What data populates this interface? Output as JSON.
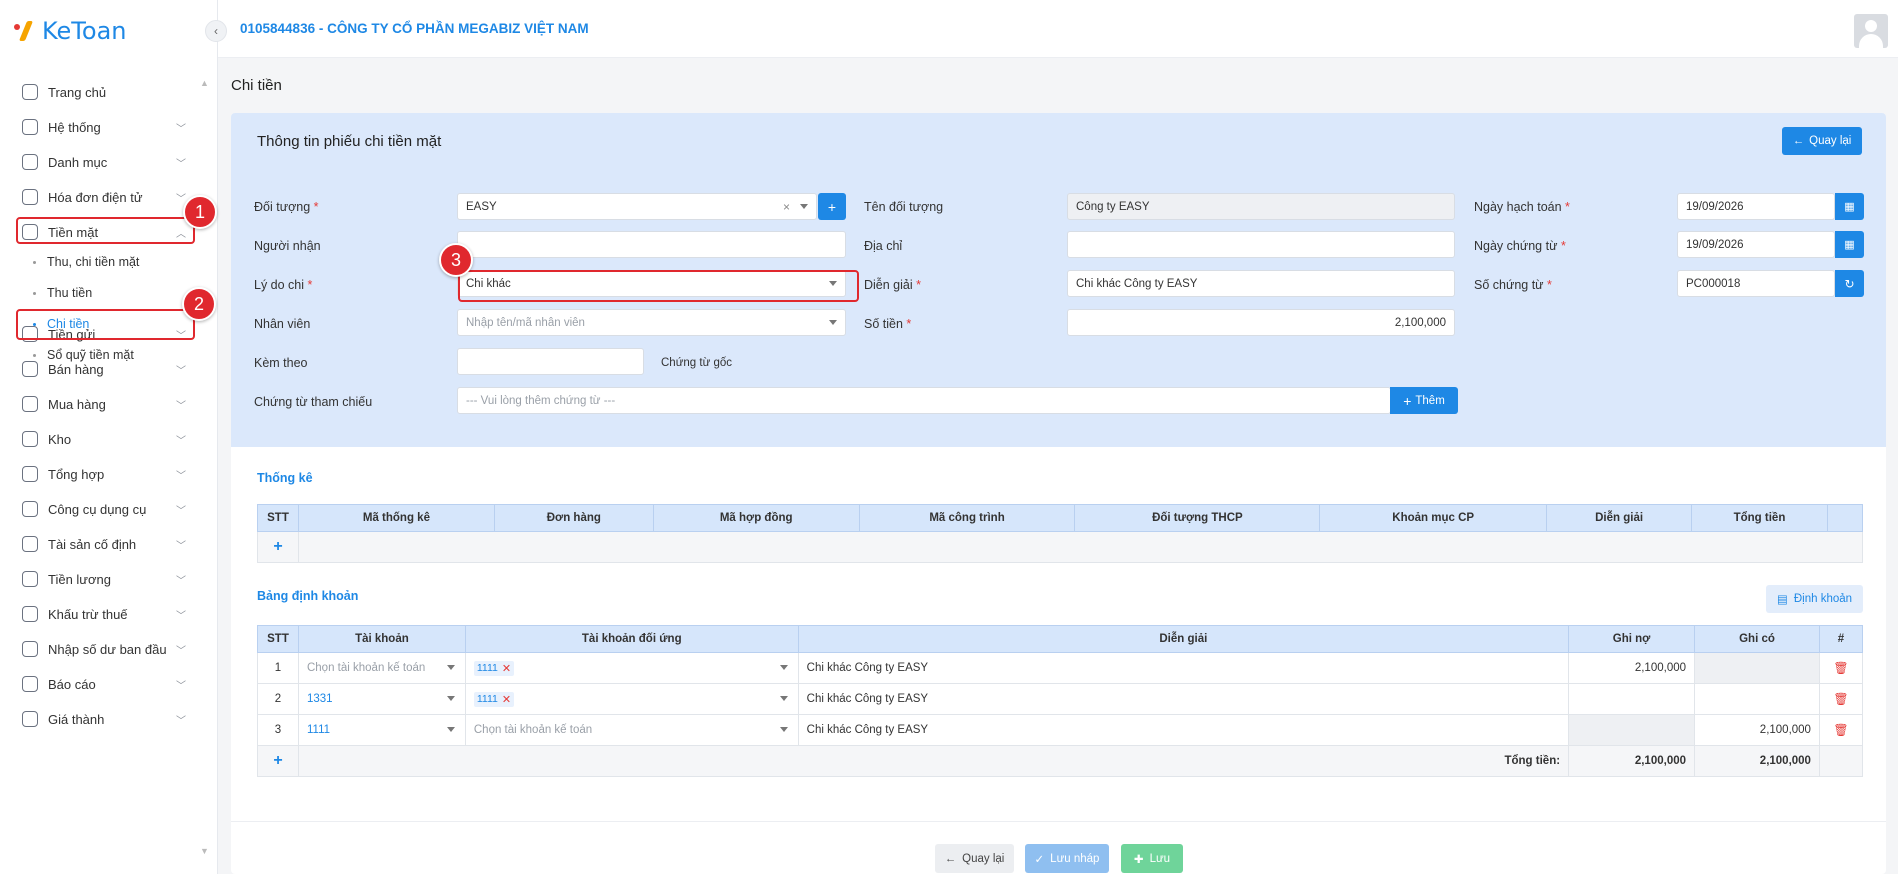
{
  "app": {
    "logo_text": "KeToan",
    "company": "0105844836 - CÔNG TY CỔ PHẦN MEGABIZ VIỆT NAM"
  },
  "sidebar": {
    "items": [
      {
        "label": "Trang chủ",
        "icon": "home-icon",
        "chevron": false
      },
      {
        "label": "Hệ thống",
        "icon": "gear-icon",
        "chevron": true
      },
      {
        "label": "Danh mục",
        "icon": "grid-icon",
        "chevron": true
      },
      {
        "label": "Hóa đơn điện tử",
        "icon": "invoice-icon",
        "chevron": true
      },
      {
        "label": "Tiền mặt",
        "icon": "cash-icon",
        "chevron": true,
        "expanded": true
      },
      {
        "label": "Tiền gửi",
        "icon": "bank-icon",
        "chevron": true
      },
      {
        "label": "Bán hàng",
        "icon": "sales-icon",
        "chevron": true
      },
      {
        "label": "Mua hàng",
        "icon": "cart-icon",
        "chevron": true
      },
      {
        "label": "Kho",
        "icon": "warehouse-icon",
        "chevron": true
      },
      {
        "label": "Tổng hợp",
        "icon": "chart-icon",
        "chevron": true
      },
      {
        "label": "Công cụ dụng cụ",
        "icon": "tools-icon",
        "chevron": true
      },
      {
        "label": "Tài sản cố định",
        "icon": "car-icon",
        "chevron": true
      },
      {
        "label": "Tiền lương",
        "icon": "salary-icon",
        "chevron": true
      },
      {
        "label": "Khấu trừ thuế",
        "icon": "tax-icon",
        "chevron": true
      },
      {
        "label": "Nhập số dư ban đầu",
        "icon": "balance-icon",
        "chevron": true
      },
      {
        "label": "Báo cáo",
        "icon": "report-icon",
        "chevron": true
      },
      {
        "label": "Giá thành",
        "icon": "cost-icon",
        "chevron": true
      }
    ],
    "sub_items": [
      {
        "label": "Thu, chi tiền mặt",
        "active": false
      },
      {
        "label": "Thu tiền",
        "active": false
      },
      {
        "label": "Chi tiền",
        "active": true
      },
      {
        "label": "Sổ quỹ tiền mặt",
        "active": false
      }
    ]
  },
  "page": {
    "title": "Chi tiền"
  },
  "form": {
    "title": "Thông tin phiếu chi tiền mặt",
    "back_label": "Quay lại",
    "doi_tuong": {
      "label": "Đối tượng",
      "value": "EASY"
    },
    "ten_doi_tuong": {
      "label": "Tên đối tượng",
      "value": "Công ty EASY"
    },
    "ngay_hach_toan": {
      "label": "Ngày hạch toán",
      "value": "19/09/2026"
    },
    "nguoi_nhan": {
      "label": "Người nhận",
      "value": ""
    },
    "dia_chi": {
      "label": "Địa chỉ",
      "value": ""
    },
    "ngay_chung_tu": {
      "label": "Ngày chứng từ",
      "value": "19/09/2026"
    },
    "ly_do_chi": {
      "label": "Lý do chi",
      "value": "Chi khác"
    },
    "dien_giai": {
      "label": "Diễn giải",
      "value": "Chi khác Công ty EASY"
    },
    "so_chung_tu": {
      "label": "Số chứng từ",
      "value": "PC000018"
    },
    "nhan_vien": {
      "label": "Nhân viên",
      "placeholder": "Nhập tên/mã nhân viên"
    },
    "so_tien": {
      "label": "Số tiền",
      "value": "2,100,000"
    },
    "kem_theo": {
      "label": "Kèm theo",
      "value": "",
      "suffix": "Chứng từ gốc"
    },
    "chung_tu_tham_chieu": {
      "label": "Chứng từ tham chiếu",
      "placeholder": "--- Vui lòng thêm chứng từ ---",
      "add_label": "Thêm"
    }
  },
  "thong_ke": {
    "title": "Thống kê",
    "columns": [
      "STT",
      "Mã thống kê",
      "Đơn hàng",
      "Mã hợp đồng",
      "Mã công trình",
      "Đối tượng THCP",
      "Khoản mục CP",
      "Diễn giải",
      "Tổng tiền",
      ""
    ]
  },
  "dinh_khoan": {
    "title": "Bảng định khoản",
    "button_label": "Định khoản",
    "columns": [
      "STT",
      "Tài khoản",
      "Tài khoản đối ứng",
      "Diễn giải",
      "Ghi nợ",
      "Ghi có",
      "#"
    ],
    "account_placeholder": "Chọn tài khoản kế toán",
    "rows": [
      {
        "stt": "1",
        "tai_khoan": "",
        "doi_ung": "1111",
        "dien_giai": "Chi khác Công ty EASY",
        "ghi_no": "2,100,000",
        "ghi_co": ""
      },
      {
        "stt": "2",
        "tai_khoan": "1331",
        "doi_ung": "1111",
        "dien_giai": "Chi khác Công ty EASY",
        "ghi_no": "",
        "ghi_co": ""
      },
      {
        "stt": "3",
        "tai_khoan": "1111",
        "doi_ung": "",
        "dien_giai": "Chi khác Công ty EASY",
        "ghi_no": "",
        "ghi_co": "2,100,000"
      }
    ],
    "total_label": "Tổng tiền:",
    "total_no": "2,100,000",
    "total_co": "2,100,000"
  },
  "footer": {
    "back_label": "Quay lại",
    "draft_label": "Lưu nháp",
    "save_label": "Lưu"
  },
  "markers": [
    "1",
    "2",
    "3"
  ],
  "colors": {
    "accent": "#1e88e5",
    "marker": "#e0282e",
    "header_bg": "#dbe8fb"
  }
}
